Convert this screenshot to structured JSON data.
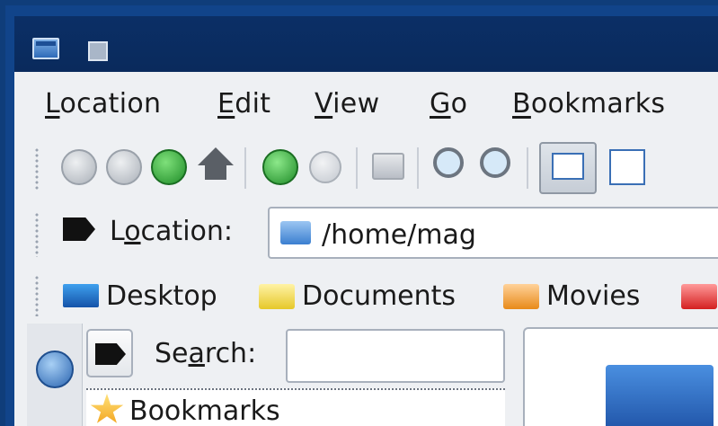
{
  "menubar": {
    "items": [
      {
        "label_first": "L",
        "label_rest": "ocation"
      },
      {
        "label_first": "E",
        "label_rest": "dit"
      },
      {
        "label_first": "V",
        "label_rest": "iew"
      },
      {
        "label_first": "G",
        "label_rest": "o"
      },
      {
        "label_first": "B",
        "label_rest": "ookmarks"
      }
    ]
  },
  "toolbar": {
    "icons": [
      "back-icon",
      "forward-icon",
      "up-icon",
      "home-icon",
      "reload-icon",
      "stop-icon",
      "print-icon",
      "zoom-in-icon",
      "zoom-out-icon",
      "icon-view-icon",
      "list-view-icon"
    ]
  },
  "location": {
    "label_pre": "L",
    "label_accel": "o",
    "label_post": "cation:",
    "value": "/home/mag"
  },
  "bookmarks_bar": {
    "items": [
      "Desktop",
      "Documents",
      "Movies"
    ]
  },
  "sidebar": {
    "search_pre": "Se",
    "search_accel": "a",
    "search_post": "rch:",
    "search_value": "",
    "list_first": "Bookmarks"
  },
  "colors": {
    "titlebar": "#0b2f66",
    "chrome": "#eef0f3",
    "accent": "#2e6ab8"
  }
}
